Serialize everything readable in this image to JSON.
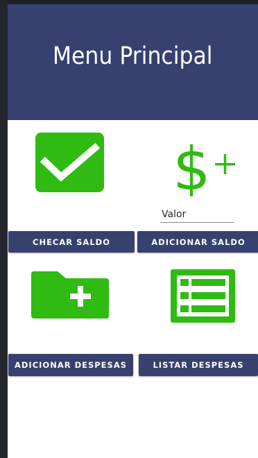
{
  "header": {
    "title": "Menu Principal"
  },
  "buttons": {
    "checar_saldo": "CHECAR SALDO",
    "adicionar_saldo": "ADICIONAR SALDO",
    "adicionar_despesas": "ADICIONAR DESPESAS",
    "listar_despesas": "LISTAR DESPESAS"
  },
  "valor_input": {
    "placeholder": "Valor",
    "value": ""
  },
  "icons": {
    "checkmark": "checkmark-icon",
    "dollar_plus": "dollar-plus-icon",
    "folder_add": "folder-add-icon",
    "list": "list-icon"
  },
  "colors": {
    "primary": "#36416f",
    "accent_green": "#2fbb12",
    "background": "#ffffff"
  }
}
